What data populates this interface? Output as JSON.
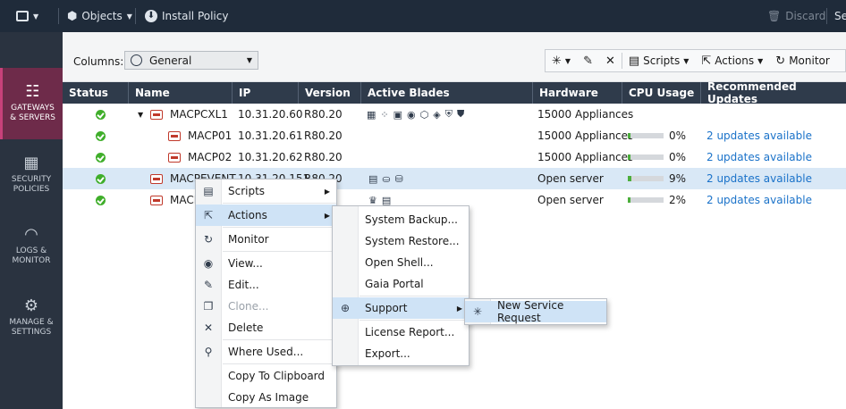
{
  "topbar": {
    "objects_label": "Objects",
    "install_label": "Install Policy",
    "discard_label": "Discard",
    "right_cut_label": "Se"
  },
  "sidebar": {
    "items": [
      {
        "label1": "GATEWAYS",
        "label2": "& SERVERS",
        "icon": "gateways-icon"
      },
      {
        "label1": "SECURITY",
        "label2": "POLICIES",
        "icon": "policies-icon"
      },
      {
        "label1": "LOGS &",
        "label2": "MONITOR",
        "icon": "gauge-icon"
      },
      {
        "label1": "MANAGE &",
        "label2": "SETTINGS",
        "icon": "gear-icon"
      }
    ]
  },
  "columns_bar": {
    "label": "Columns:",
    "selected": "General"
  },
  "toolbar": {
    "scripts": "Scripts",
    "actions": "Actions",
    "monitor": "Monitor"
  },
  "grid": {
    "headers": [
      "Status",
      "Name",
      "IP",
      "Version",
      "Active Blades",
      "Hardware",
      "CPU Usage",
      "Recommended Updates"
    ],
    "rows": [
      {
        "name": "MACPCXL1",
        "ip": "10.31.20.60",
        "version": "R80.20",
        "hardware": "15000 Appliances",
        "cpu": "",
        "updates": ""
      },
      {
        "name": "MACP01",
        "ip": "10.31.20.61",
        "version": "R80.20",
        "hardware": "15000 Appliances",
        "cpu": "0%",
        "updates": "2 updates available"
      },
      {
        "name": "MACP02",
        "ip": "10.31.20.62",
        "version": "R80.20",
        "hardware": "15000 Appliances",
        "cpu": "0%",
        "updates": "2 updates available"
      },
      {
        "name": "MACPEVENT",
        "ip": "10.31.20.151",
        "version": "R80.20",
        "hardware": "Open server",
        "cpu": "9%",
        "updates": "2 updates available"
      },
      {
        "name": "MACP",
        "ip": "",
        "version": "",
        "hardware": "Open server",
        "cpu": "2%",
        "updates": "2 updates available"
      }
    ]
  },
  "cpu_levels": [
    null,
    0.0,
    0.0,
    0.09,
    0.02
  ],
  "context_menu": {
    "items": [
      "Scripts",
      "Actions",
      "Monitor",
      "View...",
      "Edit...",
      "Clone...",
      "Delete",
      "Where Used...",
      "Copy To Clipboard",
      "Copy As Image"
    ]
  },
  "actions_menu": {
    "items": [
      "System Backup...",
      "System Restore...",
      "Open Shell...",
      "Gaia Portal",
      "Support",
      "License Report...",
      "Export..."
    ]
  },
  "support_menu": {
    "items": [
      "New Service Request"
    ]
  },
  "colors": {
    "topbar": "#1f2b3a",
    "sidebar": "#2a3340",
    "sidebar_active": "#6e2b4a",
    "grid_header": "#2f3b4b",
    "selection": "#d9e8f6",
    "link": "#1a72c9",
    "status_ok": "#3fae2a"
  }
}
